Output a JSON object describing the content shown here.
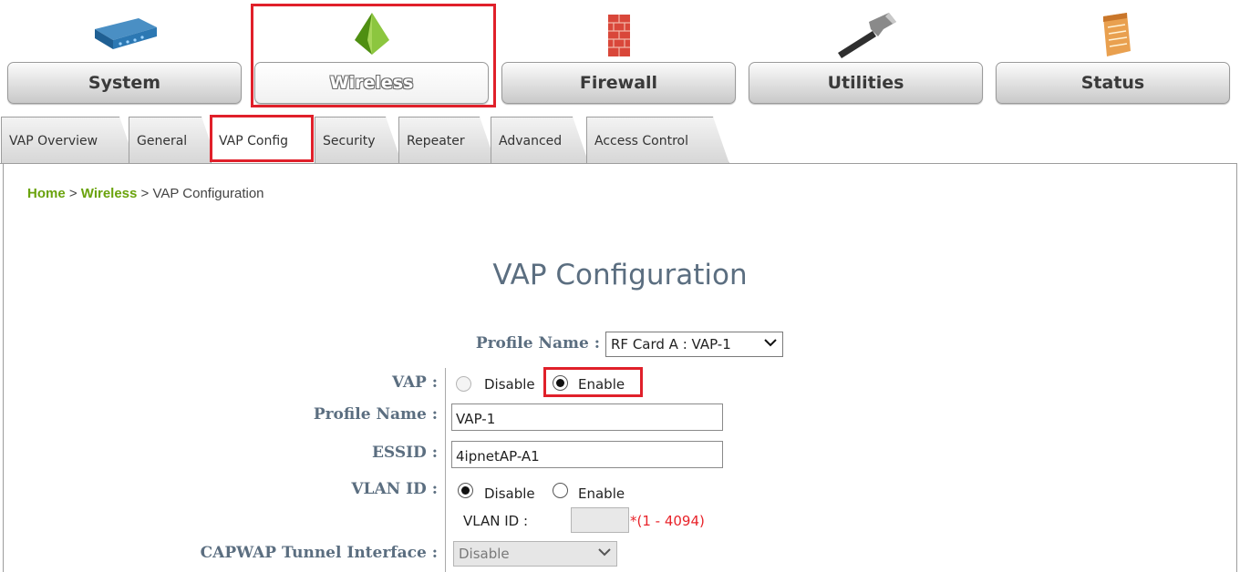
{
  "top_menu": {
    "items": [
      {
        "label": "System",
        "icon": "network-device-icon"
      },
      {
        "label": "Wireless",
        "icon": "wireless-pyramid-icon",
        "active": true
      },
      {
        "label": "Firewall",
        "icon": "brick-firewall-icon"
      },
      {
        "label": "Utilities",
        "icon": "hammer-icon"
      },
      {
        "label": "Status",
        "icon": "notepad-icon"
      }
    ]
  },
  "tabs": [
    {
      "label": "VAP Overview"
    },
    {
      "label": "General"
    },
    {
      "label": "VAP Config",
      "active": true
    },
    {
      "label": "Security"
    },
    {
      "label": "Repeater"
    },
    {
      "label": "Advanced"
    },
    {
      "label": "Access Control"
    }
  ],
  "breadcrumb": {
    "home": "Home",
    "sep1": " > ",
    "section": "Wireless",
    "sep2": " > ",
    "current": "VAP Configuration"
  },
  "page": {
    "title": "VAP Configuration"
  },
  "form": {
    "profile_select": {
      "label": "Profile Name :",
      "value": "RF Card A : VAP-1"
    },
    "vap": {
      "label": "VAP :",
      "options": [
        "Disable",
        "Enable"
      ],
      "selected": "Enable"
    },
    "profile_name": {
      "label": "Profile Name :",
      "value": "VAP-1"
    },
    "essid": {
      "label": "ESSID :",
      "value": "4ipnetAP-A1"
    },
    "vlan": {
      "label": "VLAN ID :",
      "options": [
        "Disable",
        "Enable"
      ],
      "selected": "Disable",
      "sub_label": "VLAN ID :",
      "sub_value": "",
      "range_hint": "*(1 - 4094)"
    },
    "capwap": {
      "label": "CAPWAP Tunnel Interface :",
      "value": "Disable"
    }
  },
  "colors": {
    "highlight": "#e0202a",
    "label": "#5b6e80",
    "link": "#6aa30c",
    "required": "#e8232a"
  }
}
